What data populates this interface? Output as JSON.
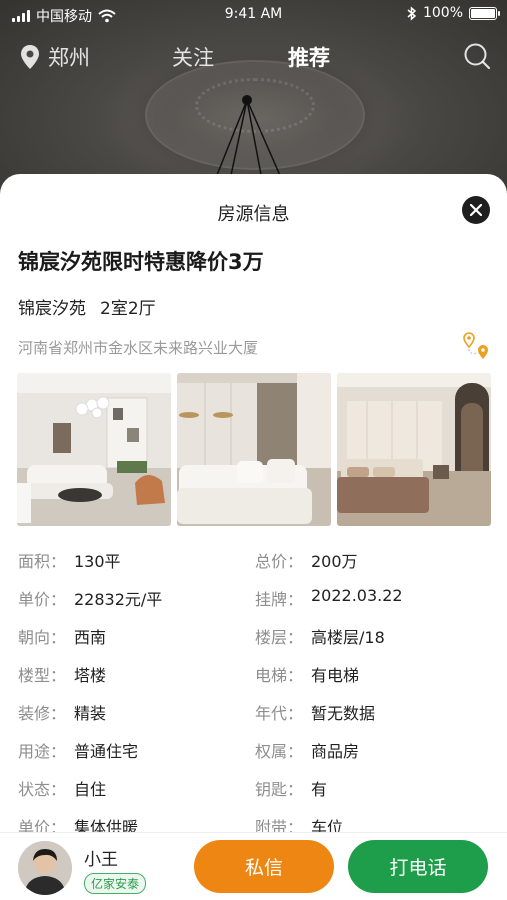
{
  "status_bar": {
    "carrier": "中国移动",
    "time": "9:41 AM",
    "battery": "100%",
    "battery_level": 1.0
  },
  "top_nav": {
    "city": "郑州",
    "tabs": [
      "关注",
      "推荐"
    ],
    "active_tab": "推荐"
  },
  "sheet": {
    "title": "房源信息",
    "listing_title": "锦宸汐苑限时特惠降价3万",
    "community": "锦宸汐苑",
    "layout": "2室2厅",
    "address": "河南省郑州市金水区未来路兴业大厦",
    "photos": [
      "living-room-photo",
      "sofa-room-photo",
      "bedroom-photo"
    ]
  },
  "info": {
    "rows": [
      [
        {
          "key": "面积：",
          "value": "130平"
        },
        {
          "key": "总价：",
          "value": "200万"
        }
      ],
      [
        {
          "key": "单价：",
          "value": "22832元/平"
        },
        {
          "key": "挂牌：",
          "value": "2022.03.22"
        }
      ],
      [
        {
          "key": "朝向：",
          "value": "西南"
        },
        {
          "key": "楼层：",
          "value": "高楼层/18"
        }
      ],
      [
        {
          "key": "楼型：",
          "value": "塔楼"
        },
        {
          "key": "电梯：",
          "value": "有电梯"
        }
      ],
      [
        {
          "key": "装修：",
          "value": "精装"
        },
        {
          "key": "年代：",
          "value": "暂无数据"
        }
      ],
      [
        {
          "key": "用途：",
          "value": "普通住宅"
        },
        {
          "key": "权属：",
          "value": "商品房"
        }
      ],
      [
        {
          "key": "状态：",
          "value": "自住"
        },
        {
          "key": "钥匙：",
          "value": "有"
        }
      ],
      [
        {
          "key": "单价：",
          "value": "集体供暖"
        },
        {
          "key": "附带：",
          "value": "车位"
        }
      ]
    ]
  },
  "agent": {
    "name": "小王",
    "company": "亿家安泰"
  },
  "actions": {
    "message": "私信",
    "call": "打电话"
  },
  "colors": {
    "message_button": "#ee8613",
    "call_button": "#1e9e4a",
    "badge": "#2e9a4e",
    "map_pin": "#f0a020"
  }
}
